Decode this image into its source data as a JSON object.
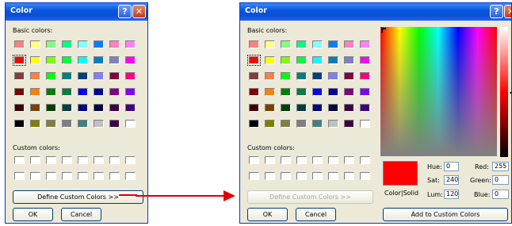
{
  "left_dialog": {
    "title": "Color",
    "help_label": "?",
    "close_label": "✕",
    "basic_colors_label": "Basic colors:",
    "custom_colors_label": "Custom colors:",
    "define_button": "Define Custom Colors >>",
    "ok_button": "OK",
    "cancel_button": "Cancel"
  },
  "right_dialog": {
    "title": "Color",
    "help_label": "?",
    "close_label": "✕",
    "basic_colors_label": "Basic colors:",
    "custom_colors_label": "Custom colors:",
    "define_button": "Define Custom Colors >>",
    "ok_button": "OK",
    "cancel_button": "Cancel",
    "color_solid_label": "Color|Solid",
    "hue_label": "Hue:",
    "hue_value": "0",
    "sat_label": "Sat:",
    "sat_value": "240",
    "lum_label": "Lum:",
    "lum_value": "120",
    "red_label": "Red:",
    "red_value": "255",
    "green_label": "Green:",
    "green_value": "0",
    "blue_label": "Blue:",
    "blue_value": "0",
    "add_button": "Add to Custom Colors"
  },
  "basic_colors": [
    [
      "#ff8080",
      "#ffff80",
      "#80ff80",
      "#00ff80",
      "#80ffff",
      "#0080ff",
      "#ff80c0",
      "#ff80ff"
    ],
    [
      "#ff0000",
      "#ffff00",
      "#80ff00",
      "#00ff40",
      "#00ffff",
      "#0080c0",
      "#8080c0",
      "#ff00ff"
    ],
    [
      "#804040",
      "#ff8040",
      "#00ff00",
      "#008080",
      "#004080",
      "#8080ff",
      "#800040",
      "#ff0080"
    ],
    [
      "#800000",
      "#ff8000",
      "#008000",
      "#008040",
      "#0000ff",
      "#0000a0",
      "#800080",
      "#8000ff"
    ],
    [
      "#400000",
      "#804000",
      "#004000",
      "#004040",
      "#000080",
      "#000040",
      "#400040",
      "#400080"
    ],
    [
      "#000000",
      "#808000",
      "#808040",
      "#808080",
      "#408080",
      "#c0c0c0",
      "#400040",
      "#ffffff"
    ]
  ],
  "selected_color": "#ff0000",
  "arrow_color": "#e00000"
}
